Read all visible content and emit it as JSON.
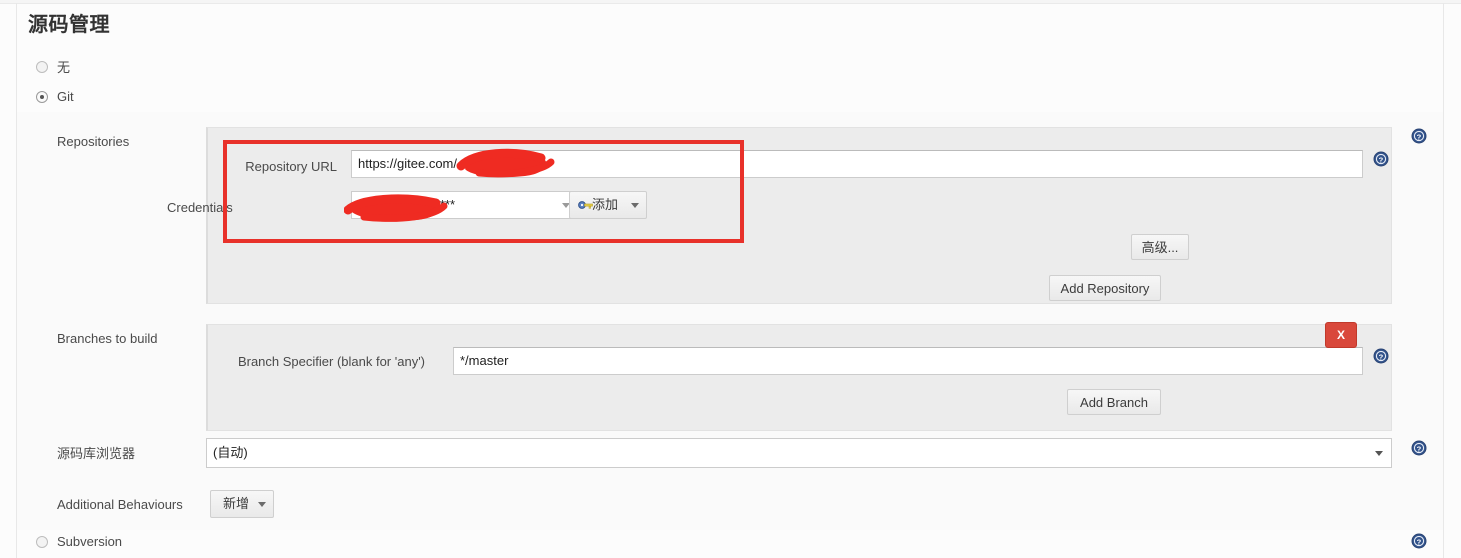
{
  "page": {
    "title": "源码管理"
  },
  "scm_options": [
    {
      "label": "无",
      "selected": false
    },
    {
      "label": "Git",
      "selected": true
    },
    {
      "label": "Subversion",
      "selected": false
    }
  ],
  "git": {
    "repositories": {
      "label": "Repositories",
      "repository_url": {
        "label": "Repository URL",
        "value": "https://gitee.com/                JenkinsTest.git"
      },
      "credentials": {
        "label": "Credentials",
        "value": "                  @163.com/******",
        "add_button": "添加",
        "add_icon": "key-icon",
        "caret_icon": "chevron-down-icon"
      },
      "advanced_button": "高级...",
      "add_repository_button": "Add Repository"
    },
    "branches": {
      "label": "Branches to build",
      "branch_specifier": {
        "label": "Branch Specifier (blank for 'any')",
        "value": "*/master"
      },
      "delete_button": "X",
      "add_branch_button": "Add Branch"
    },
    "repository_browser": {
      "label": "源码库浏览器",
      "value": "(自动)",
      "caret_icon": "chevron-down-icon"
    },
    "additional_behaviours": {
      "label": "Additional Behaviours",
      "add_button": "新增",
      "caret_icon": "chevron-down-icon"
    }
  },
  "help_icons": {
    "name": "help-icon",
    "glyph": "?"
  },
  "colors": {
    "accent_red": "#e8312a",
    "delete_red": "#d9483b",
    "help_blue": "#33548c",
    "panel_bg": "#ececec",
    "page_bg": "#fafafa"
  }
}
